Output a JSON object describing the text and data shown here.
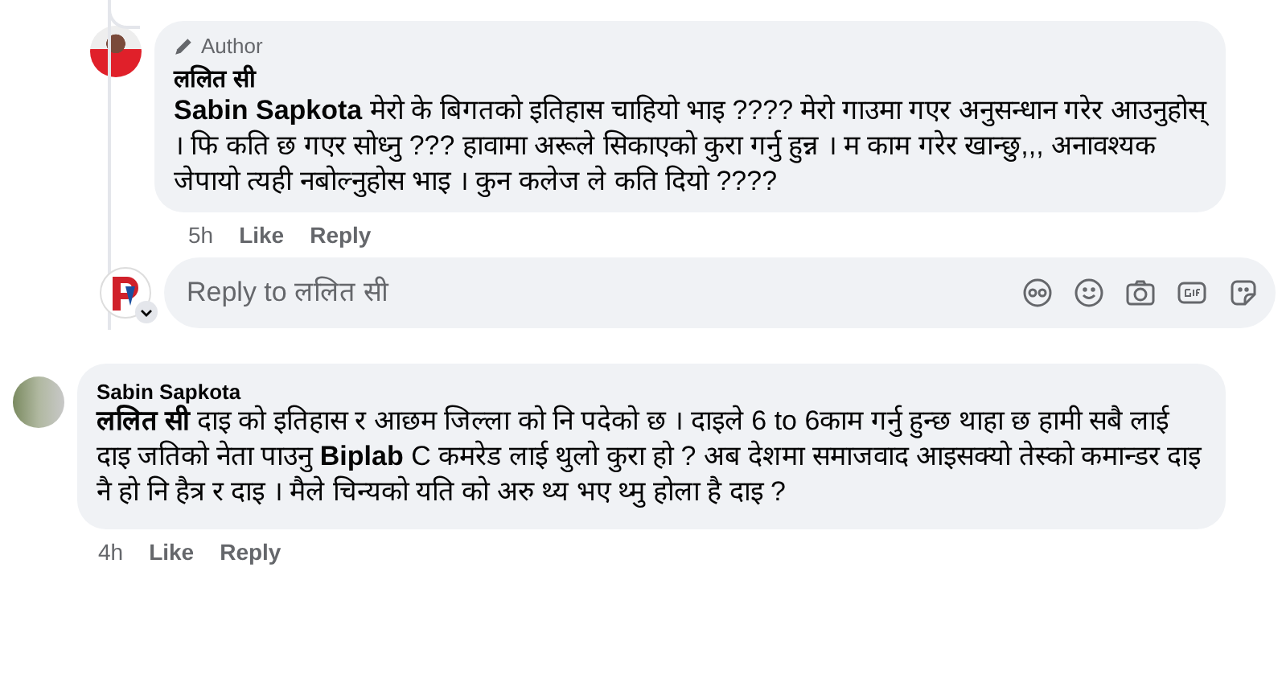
{
  "replies": [
    {
      "author_badge": "Author",
      "name": "ललित सी",
      "text": "**Sabin Sapkota** मेरो के बिगतको इतिहास चाहियो भाइ ???? मेरो गाउमा गएर अनुसन्धान गरेर आउनुहोस् । फि कति छ गएर सोध्नु ??? हावामा अरूले सिकाएको कुरा गर्नु हुन्न । म काम गरेर खान्छु,,, अनावश्यक जेपायो त्यही नबोल्नुहोस भाइ । कुन कलेज ले कति दियो ????",
      "time": "5h",
      "like": "Like",
      "reply": "Reply"
    }
  ],
  "reply_box": {
    "placeholder": "Reply to ललित सी"
  },
  "comments": [
    {
      "name": "Sabin Sapkota",
      "text": "**ललित सी** दाइ को इतिहास र आछम जिल्ला को नि पदेको छ । दाइले 6 to 6काम गर्नु हुन्छ थाहा छ हामी सबै लाई दाइ जतिको नेता पाउनु **Biplab** C कमरेड लाई थुलो कुरा हो ? अब देशमा समाजवाद आइसक्यो तेस्को कमान्डर दाइ नै हो नि हैत्र र दाइ । मैले चिन्यको यति को अरु थ्य भए थ्मु होला है दाइ ?",
      "time": "4h",
      "like": "Like",
      "reply": "Reply"
    }
  ]
}
